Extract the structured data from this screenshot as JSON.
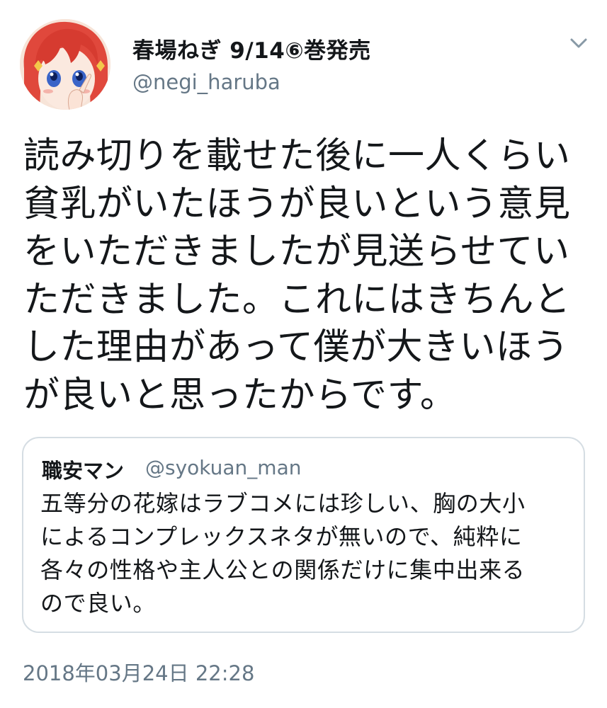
{
  "tweet": {
    "author": {
      "display_name": "春場ねぎ 9/14⑥巻発売",
      "handle": "@negi_haruba",
      "avatar_icon": "avatar-icon"
    },
    "menu_icon": "chevron-down-icon",
    "text_lines": [
      "読み切りを載せた後に一人くらい",
      "貧乳がいたほうが良いという意見",
      "をいただきましたが見送らせてい",
      "ただきました。これにはきちんと",
      "した理由があって僕が大きいほう",
      "が良いと思ったからです。"
    ],
    "quoted": {
      "display_name": "職安マン",
      "handle": "@syokuan_man",
      "text_lines": [
        "五等分の花嫁はラブコメには珍しい、胸の大小",
        "によるコンプレックスネタが無いので、純粋に",
        "各々の性格や主人公との関係だけに集中出来る",
        "ので良い。"
      ]
    },
    "timestamp": "2018年03月24日 22:28"
  },
  "colors": {
    "text": "#14171a",
    "secondary": "#657786",
    "border": "#d5dde3",
    "avatar_hair": "#e0483c"
  }
}
